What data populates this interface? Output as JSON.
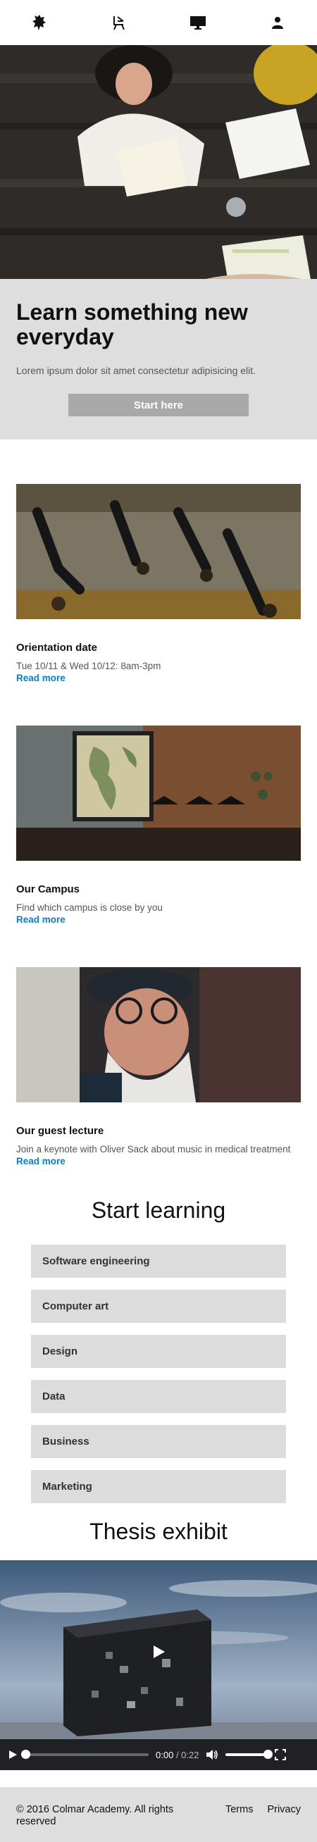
{
  "nav": {
    "items": [
      {
        "icon": "lion-crest-icon"
      },
      {
        "icon": "chair-icon"
      },
      {
        "icon": "monitor-icon"
      },
      {
        "icon": "user-icon"
      }
    ]
  },
  "hero": {
    "title": "Learn something new everyday",
    "subtitle": "Lorem ipsum dolor sit amet consectetur adipisicing elit.",
    "button_label": "Start here"
  },
  "cards": [
    {
      "title": "Orientation date",
      "text": "Tue 10/11 & Wed 10/12: 8am-3pm",
      "link": "Read more"
    },
    {
      "title": "Our Campus",
      "text": "Find which campus is close by you",
      "link": "Read more"
    },
    {
      "title": "Our guest lecture",
      "text": "Join a keynote with Oliver Sack about music in medical treatment",
      "link": "Read more"
    }
  ],
  "learning": {
    "title": "Start learning",
    "courses": [
      "Software engineering",
      "Computer art",
      "Design",
      "Data",
      "Business",
      "Marketing"
    ]
  },
  "thesis": {
    "title": "Thesis exhibit",
    "video": {
      "current_time": "0:00",
      "duration": "0:22",
      "progress": 0.0,
      "volume": 1.0
    }
  },
  "footer": {
    "copyright": "© 2016 Colmar Academy. All rights reserved",
    "links": [
      "Terms",
      "Privacy"
    ]
  },
  "colors": {
    "accent_link": "#0a7ec2",
    "panel_gray": "#dedede",
    "button_gray": "#a9a9a9"
  }
}
